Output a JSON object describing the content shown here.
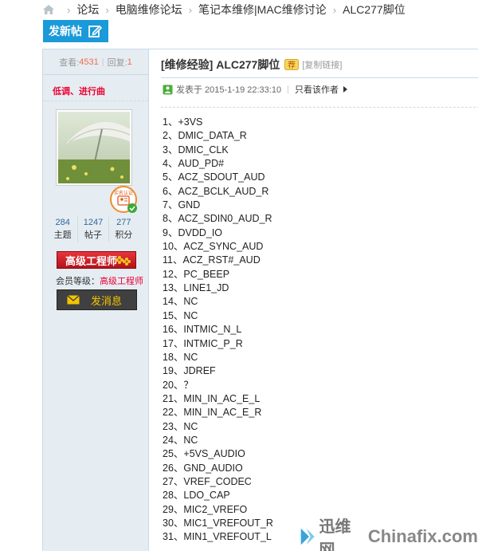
{
  "breadcrumb": {
    "items": [
      "论坛",
      "电脑维修论坛",
      "笔记本维修|MAC维修讨论",
      "ALC277脚位"
    ]
  },
  "toolbar": {
    "post_label": "发新帖"
  },
  "sidebar": {
    "views_label": "查看:",
    "views": "4531",
    "replies_label": "回复:",
    "replies": "1",
    "username": "低调、进行曲",
    "verify_badge_text": "实名认证",
    "stats": [
      {
        "value": "284",
        "label": "主题"
      },
      {
        "value": "1247",
        "label": "帖子"
      },
      {
        "value": "277",
        "label": "积分"
      }
    ],
    "rank_badge": "高级工程师",
    "level_label": "会员等级：",
    "level": "高级工程师",
    "message_button": "发消息"
  },
  "post": {
    "title": "[维修经验] ALC277脚位",
    "quality_icon_text": "荐",
    "copy_link": "[复制链接]",
    "posted_at": "发表于 2015-1-19 22:33:10",
    "author_only": "只看该作者",
    "pins": [
      "1、+3VS",
      "2、DMIC_DATA_R",
      "3、DMIC_CLK",
      "4、AUD_PD#",
      "5、ACZ_SDOUT_AUD",
      "6、ACZ_BCLK_AUD_R",
      "7、GND",
      "8、ACZ_SDIN0_AUD_R",
      "9、DVDD_IO",
      "10、ACZ_SYNC_AUD",
      "11、ACZ_RST#_AUD",
      "12、PC_BEEP",
      "13、LINE1_JD",
      "14、NC",
      "15、NC",
      "16、INTMIC_N_L",
      "17、INTMIC_P_R",
      "18、NC",
      "19、JDREF",
      "20、？",
      "21、MIN_IN_AC_E_L",
      "22、MIN_IN_AC_E_R",
      "23、NC",
      "24、NC",
      "25、+5VS_AUDIO",
      "26、GND_AUDIO",
      "27、VREF_CODEC",
      "28、LDO_CAP",
      "29、MIC2_VREFO",
      "30、MIC1_VREFOUT_R",
      "31、MIN1_VREFOUT_L"
    ]
  },
  "watermark": {
    "cn": "迅维网",
    "en": "Chinafix.com"
  },
  "colors": {
    "accent": "#1b9ad9",
    "sidebar_bg": "#e5edf2",
    "border": "#c9d9e6",
    "highlight": "#f26c4f"
  },
  "icons": [
    "home-icon",
    "edit-icon",
    "verify-icon",
    "flower-icon",
    "envelope-icon",
    "quality-icon",
    "online-icon",
    "arrow-right-icon",
    "watermark-logo-icon"
  ]
}
